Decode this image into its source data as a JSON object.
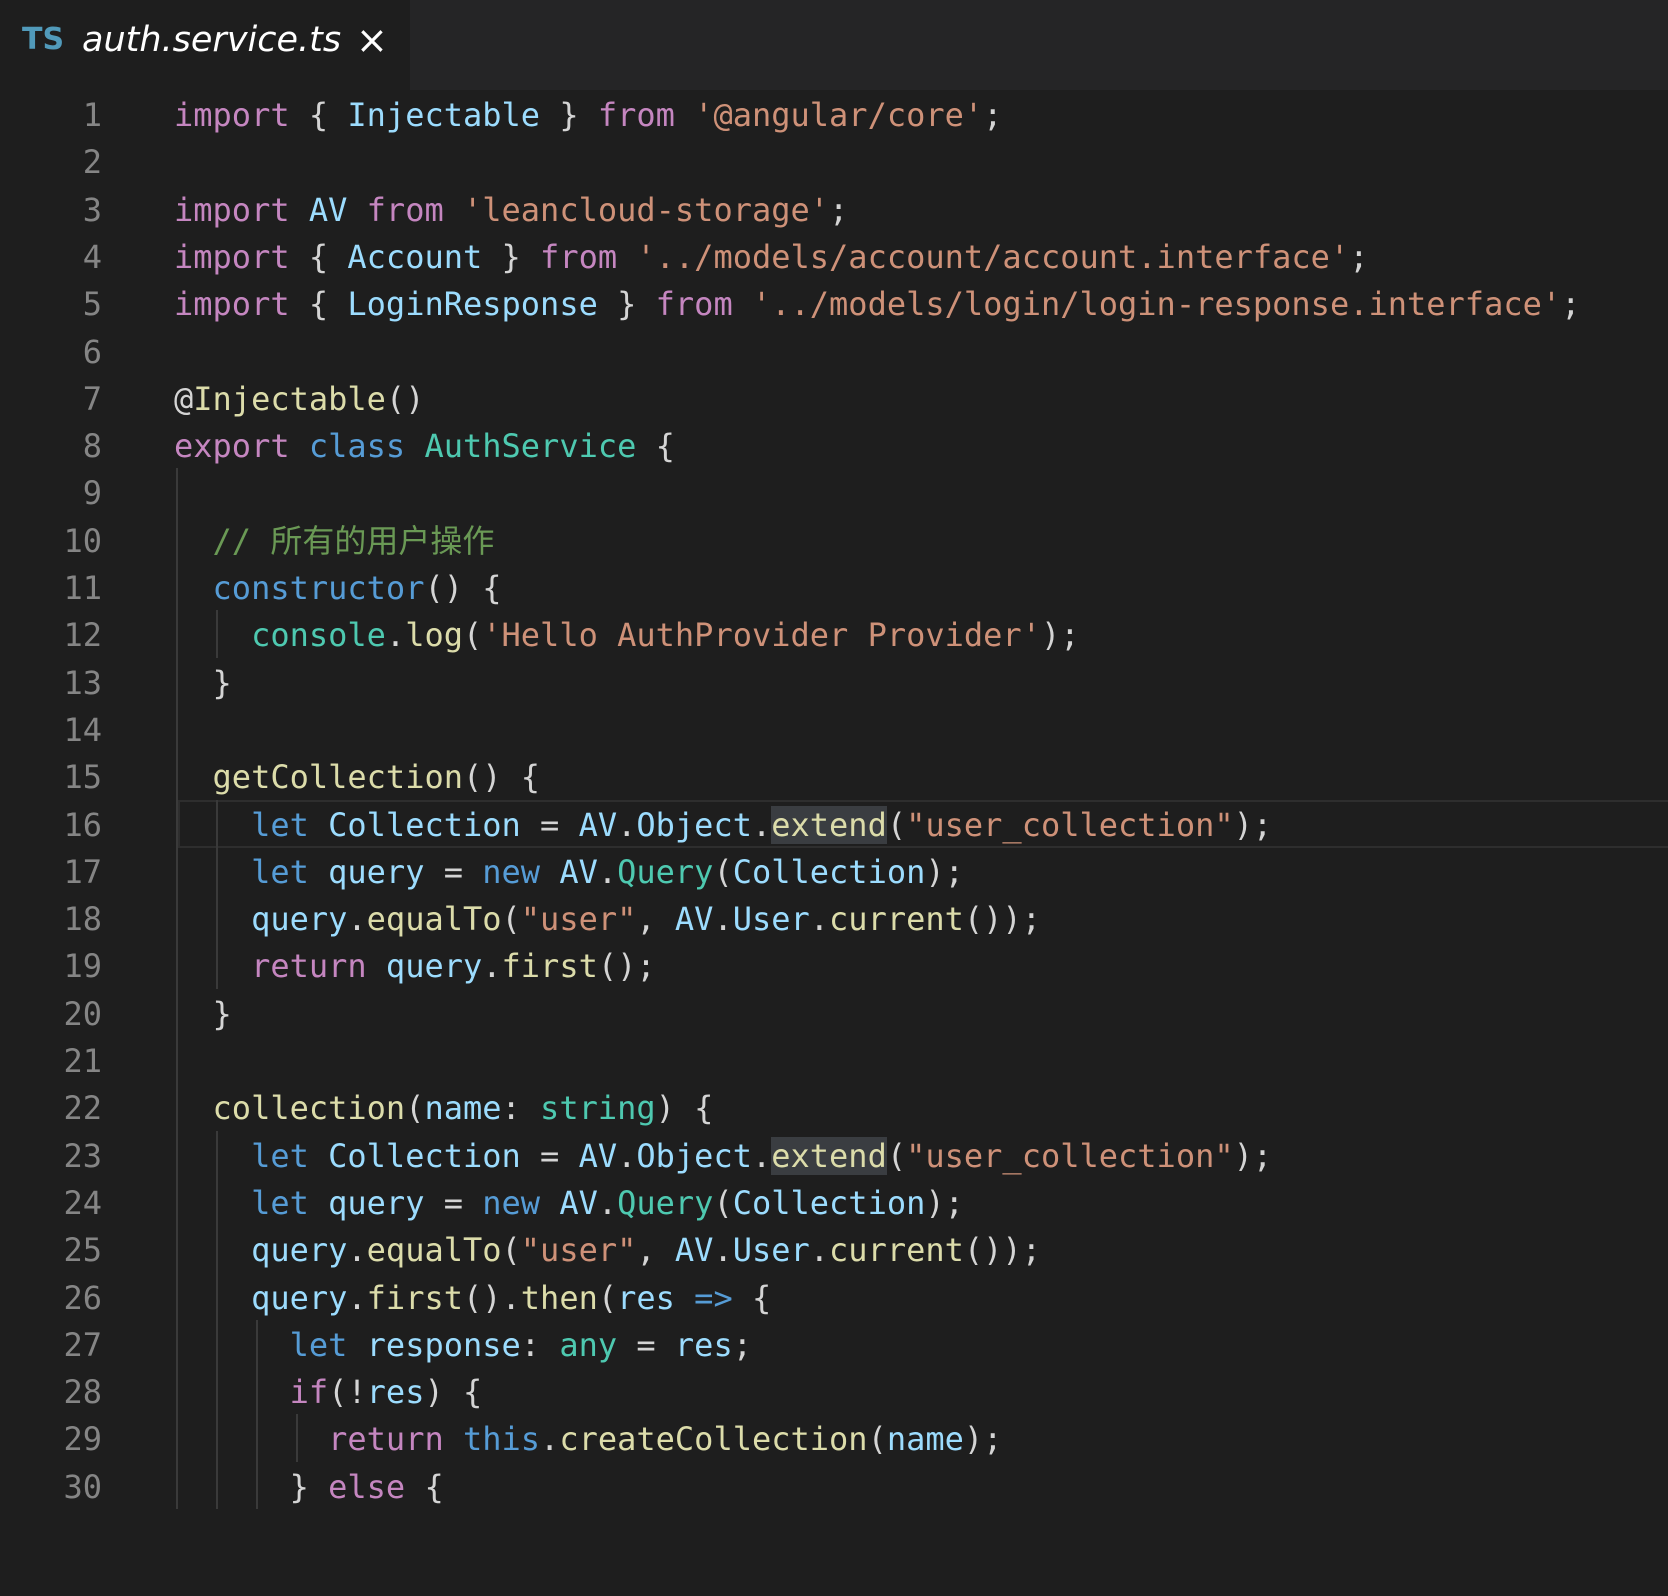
{
  "tab": {
    "icon": "TS",
    "title": "auth.service.ts",
    "close": "×"
  },
  "editor": {
    "line_numbers": [
      "1",
      "2",
      "3",
      "4",
      "5",
      "6",
      "7",
      "8",
      "9",
      "10",
      "11",
      "12",
      "13",
      "14",
      "15",
      "16",
      "17",
      "18",
      "19",
      "20",
      "21",
      "22",
      "23",
      "24",
      "25",
      "26",
      "27",
      "28",
      "29",
      "30"
    ],
    "lines": [
      [
        [
          "kw",
          "import"
        ],
        [
          "pl",
          " { "
        ],
        [
          "vr",
          "Injectable"
        ],
        [
          "pl",
          " } "
        ],
        [
          "kw",
          "from"
        ],
        [
          "pl",
          " "
        ],
        [
          "st",
          "'@angular/core'"
        ],
        [
          "pl",
          ";"
        ]
      ],
      [],
      [
        [
          "kw",
          "import"
        ],
        [
          "pl",
          " "
        ],
        [
          "vr",
          "AV"
        ],
        [
          "pl",
          " "
        ],
        [
          "kw",
          "from"
        ],
        [
          "pl",
          " "
        ],
        [
          "st",
          "'leancloud-storage'"
        ],
        [
          "pl",
          ";"
        ]
      ],
      [
        [
          "kw",
          "import"
        ],
        [
          "pl",
          " { "
        ],
        [
          "vr",
          "Account"
        ],
        [
          "pl",
          " } "
        ],
        [
          "kw",
          "from"
        ],
        [
          "pl",
          " "
        ],
        [
          "st",
          "'../models/account/account.interface'"
        ],
        [
          "pl",
          ";"
        ]
      ],
      [
        [
          "kw",
          "import"
        ],
        [
          "pl",
          " { "
        ],
        [
          "vr",
          "LoginResponse"
        ],
        [
          "pl",
          " } "
        ],
        [
          "kw",
          "from"
        ],
        [
          "pl",
          " "
        ],
        [
          "st",
          "'../models/login/login-response.interface'"
        ],
        [
          "pl",
          ";"
        ]
      ],
      [],
      [
        [
          "pl",
          "@"
        ],
        [
          "fn",
          "Injectable"
        ],
        [
          "pl",
          "()"
        ]
      ],
      [
        [
          "kw",
          "export"
        ],
        [
          "pl",
          " "
        ],
        [
          "bl",
          "class"
        ],
        [
          "pl",
          " "
        ],
        [
          "ty",
          "AuthService"
        ],
        [
          "pl",
          " {"
        ]
      ],
      [],
      [
        [
          "pl",
          "  "
        ],
        [
          "cm",
          "// 所有的用户操作"
        ]
      ],
      [
        [
          "pl",
          "  "
        ],
        [
          "bl",
          "constructor"
        ],
        [
          "pl",
          "() {"
        ]
      ],
      [
        [
          "pl",
          "    "
        ],
        [
          "ty",
          "console"
        ],
        [
          "pl",
          "."
        ],
        [
          "fn",
          "log"
        ],
        [
          "pl",
          "("
        ],
        [
          "st",
          "'Hello AuthProvider Provider'"
        ],
        [
          "pl",
          ");"
        ]
      ],
      [
        [
          "pl",
          "  }"
        ]
      ],
      [],
      [
        [
          "pl",
          "  "
        ],
        [
          "fn",
          "getCollection"
        ],
        [
          "pl",
          "() {"
        ]
      ],
      [
        [
          "pl",
          "    "
        ],
        [
          "bl",
          "let"
        ],
        [
          "pl",
          " "
        ],
        [
          "vr",
          "Collection"
        ],
        [
          "pl",
          " = "
        ],
        [
          "vr",
          "AV"
        ],
        [
          "pl",
          "."
        ],
        [
          "vr",
          "Object"
        ],
        [
          "pl",
          "."
        ],
        [
          "fn hl",
          "extend"
        ],
        [
          "pl",
          "("
        ],
        [
          "st",
          "\"user_collection\""
        ],
        [
          "pl",
          ");"
        ]
      ],
      [
        [
          "pl",
          "    "
        ],
        [
          "bl",
          "let"
        ],
        [
          "pl",
          " "
        ],
        [
          "vr",
          "query"
        ],
        [
          "pl",
          " = "
        ],
        [
          "bl",
          "new"
        ],
        [
          "pl",
          " "
        ],
        [
          "vr",
          "AV"
        ],
        [
          "pl",
          "."
        ],
        [
          "ty",
          "Query"
        ],
        [
          "pl",
          "("
        ],
        [
          "vr",
          "Collection"
        ],
        [
          "pl",
          ");"
        ]
      ],
      [
        [
          "pl",
          "    "
        ],
        [
          "vr",
          "query"
        ],
        [
          "pl",
          "."
        ],
        [
          "fn",
          "equalTo"
        ],
        [
          "pl",
          "("
        ],
        [
          "st",
          "\"user\""
        ],
        [
          "pl",
          ", "
        ],
        [
          "vr",
          "AV"
        ],
        [
          "pl",
          "."
        ],
        [
          "vr",
          "User"
        ],
        [
          "pl",
          "."
        ],
        [
          "fn",
          "current"
        ],
        [
          "pl",
          "());"
        ]
      ],
      [
        [
          "pl",
          "    "
        ],
        [
          "kw",
          "return"
        ],
        [
          "pl",
          " "
        ],
        [
          "vr",
          "query"
        ],
        [
          "pl",
          "."
        ],
        [
          "fn",
          "first"
        ],
        [
          "pl",
          "();"
        ]
      ],
      [
        [
          "pl",
          "  }"
        ]
      ],
      [],
      [
        [
          "pl",
          "  "
        ],
        [
          "fn",
          "collection"
        ],
        [
          "pl",
          "("
        ],
        [
          "vr",
          "name"
        ],
        [
          "pl",
          ": "
        ],
        [
          "ty",
          "string"
        ],
        [
          "pl",
          ") {"
        ]
      ],
      [
        [
          "pl",
          "    "
        ],
        [
          "bl",
          "let"
        ],
        [
          "pl",
          " "
        ],
        [
          "vr",
          "Collection"
        ],
        [
          "pl",
          " = "
        ],
        [
          "vr",
          "AV"
        ],
        [
          "pl",
          "."
        ],
        [
          "vr",
          "Object"
        ],
        [
          "pl",
          "."
        ],
        [
          "fn hl",
          "extend"
        ],
        [
          "pl",
          "("
        ],
        [
          "st",
          "\"user_collection\""
        ],
        [
          "pl",
          ");"
        ]
      ],
      [
        [
          "pl",
          "    "
        ],
        [
          "bl",
          "let"
        ],
        [
          "pl",
          " "
        ],
        [
          "vr",
          "query"
        ],
        [
          "pl",
          " = "
        ],
        [
          "bl",
          "new"
        ],
        [
          "pl",
          " "
        ],
        [
          "vr",
          "AV"
        ],
        [
          "pl",
          "."
        ],
        [
          "ty",
          "Query"
        ],
        [
          "pl",
          "("
        ],
        [
          "vr",
          "Collection"
        ],
        [
          "pl",
          ");"
        ]
      ],
      [
        [
          "pl",
          "    "
        ],
        [
          "vr",
          "query"
        ],
        [
          "pl",
          "."
        ],
        [
          "fn",
          "equalTo"
        ],
        [
          "pl",
          "("
        ],
        [
          "st",
          "\"user\""
        ],
        [
          "pl",
          ", "
        ],
        [
          "vr",
          "AV"
        ],
        [
          "pl",
          "."
        ],
        [
          "vr",
          "User"
        ],
        [
          "pl",
          "."
        ],
        [
          "fn",
          "current"
        ],
        [
          "pl",
          "());"
        ]
      ],
      [
        [
          "pl",
          "    "
        ],
        [
          "vr",
          "query"
        ],
        [
          "pl",
          "."
        ],
        [
          "fn",
          "first"
        ],
        [
          "pl",
          "()."
        ],
        [
          "fn",
          "then"
        ],
        [
          "pl",
          "("
        ],
        [
          "vr",
          "res"
        ],
        [
          "pl",
          " "
        ],
        [
          "bl",
          "=>"
        ],
        [
          "pl",
          " {"
        ]
      ],
      [
        [
          "pl",
          "      "
        ],
        [
          "bl",
          "let"
        ],
        [
          "pl",
          " "
        ],
        [
          "vr",
          "response"
        ],
        [
          "pl",
          ": "
        ],
        [
          "ty",
          "any"
        ],
        [
          "pl",
          " = "
        ],
        [
          "vr",
          "res"
        ],
        [
          "pl",
          ";"
        ]
      ],
      [
        [
          "pl",
          "      "
        ],
        [
          "kw",
          "if"
        ],
        [
          "pl",
          "(!"
        ],
        [
          "vr",
          "res"
        ],
        [
          "pl",
          ") {"
        ]
      ],
      [
        [
          "pl",
          "        "
        ],
        [
          "kw",
          "return"
        ],
        [
          "pl",
          " "
        ],
        [
          "bl",
          "this"
        ],
        [
          "pl",
          "."
        ],
        [
          "fn",
          "createCollection"
        ],
        [
          "pl",
          "("
        ],
        [
          "vr",
          "name"
        ],
        [
          "pl",
          ");"
        ]
      ],
      [
        [
          "pl",
          "      } "
        ],
        [
          "kw",
          "else"
        ],
        [
          "pl",
          " {"
        ]
      ]
    ]
  }
}
